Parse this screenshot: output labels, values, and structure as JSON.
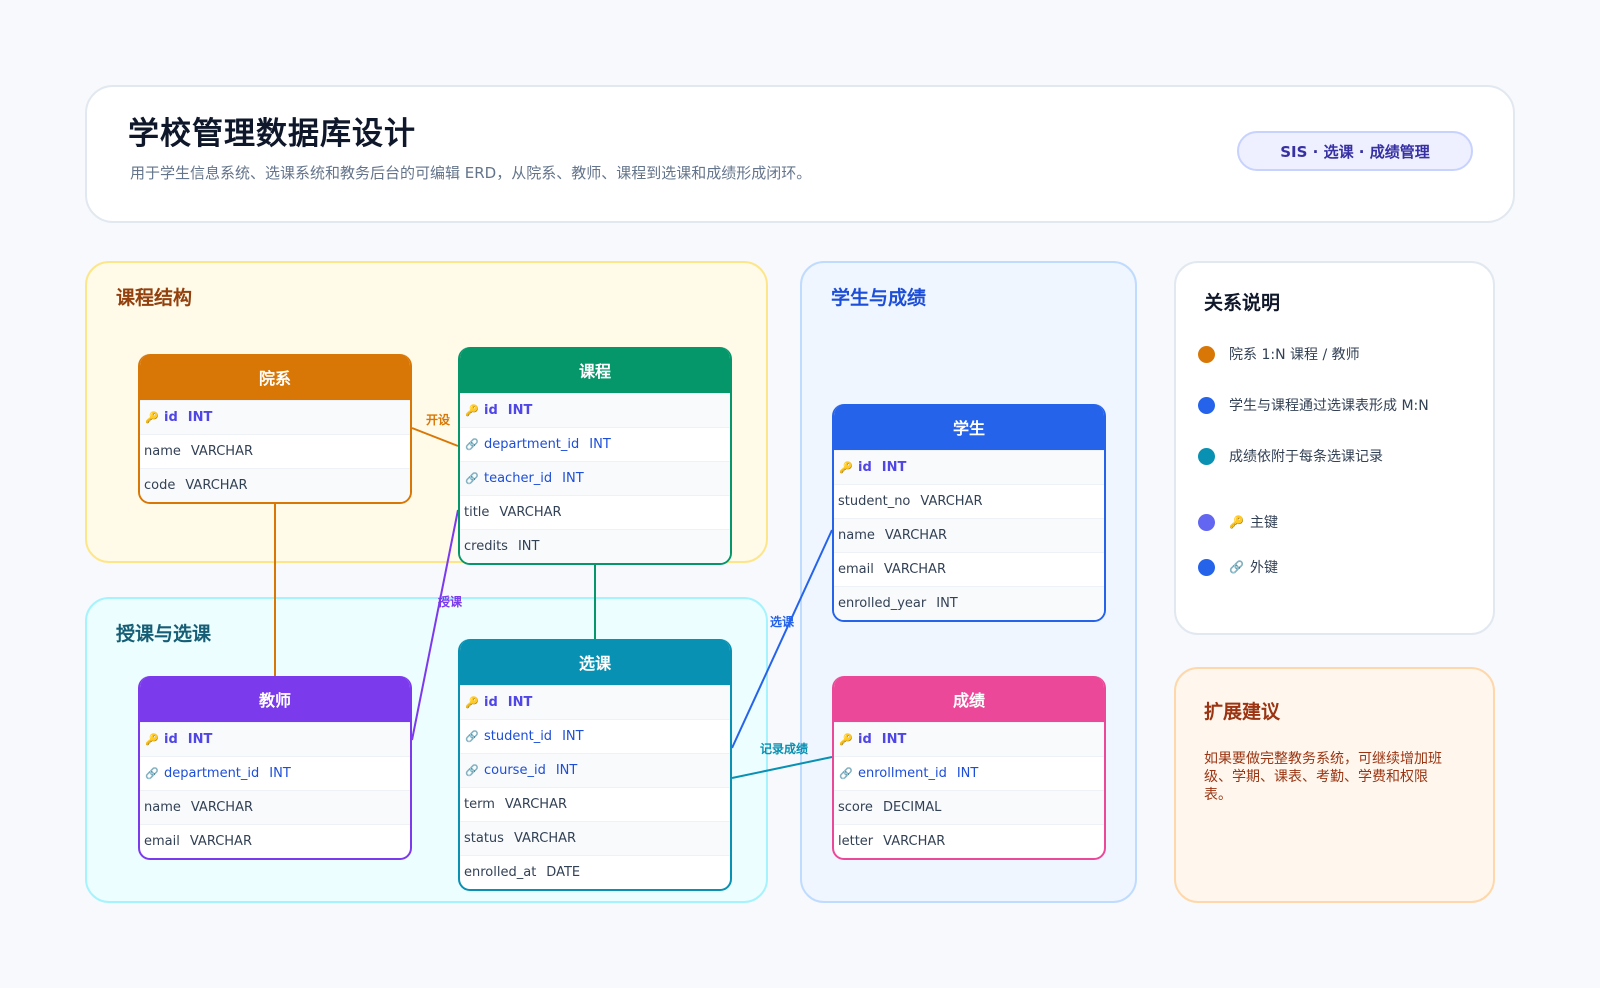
{
  "header": {
    "title": "学校管理数据库设计",
    "subtitle": "用于学生信息系统、选课系统和教务后台的可编辑 ERD，从院系、教师、课程到选课和成绩形成闭环。",
    "badge": "SIS · 选课 · 成绩管理"
  },
  "groups": {
    "course": "课程结构",
    "teach": "授课与选课",
    "student": "学生与成绩"
  },
  "entities": {
    "department": {
      "name": "院系",
      "color": "#d97706",
      "fields": [
        {
          "name": "id",
          "type": "INT",
          "key": "pk",
          "icon": "key-icon"
        },
        {
          "name": "name",
          "type": "VARCHAR",
          "key": ""
        },
        {
          "name": "code",
          "type": "VARCHAR",
          "key": ""
        }
      ]
    },
    "course": {
      "name": "课程",
      "color": "#059669",
      "fields": [
        {
          "name": "id",
          "type": "INT",
          "key": "pk",
          "icon": "key-icon"
        },
        {
          "name": "department_id",
          "type": "INT",
          "key": "fk",
          "icon": "link-icon"
        },
        {
          "name": "teacher_id",
          "type": "INT",
          "key": "fk",
          "icon": "link-icon"
        },
        {
          "name": "title",
          "type": "VARCHAR",
          "key": ""
        },
        {
          "name": "credits",
          "type": "INT",
          "key": ""
        }
      ]
    },
    "teacher": {
      "name": "教师",
      "color": "#7c3aed",
      "fields": [
        {
          "name": "id",
          "type": "INT",
          "key": "pk",
          "icon": "key-icon"
        },
        {
          "name": "department_id",
          "type": "INT",
          "key": "fk",
          "icon": "link-icon"
        },
        {
          "name": "name",
          "type": "VARCHAR",
          "key": ""
        },
        {
          "name": "email",
          "type": "VARCHAR",
          "key": ""
        }
      ]
    },
    "enrollment": {
      "name": "选课",
      "color": "#0891b2",
      "fields": [
        {
          "name": "id",
          "type": "INT",
          "key": "pk",
          "icon": "key-icon"
        },
        {
          "name": "student_id",
          "type": "INT",
          "key": "fk",
          "icon": "link-icon"
        },
        {
          "name": "course_id",
          "type": "INT",
          "key": "fk",
          "icon": "link-icon"
        },
        {
          "name": "term",
          "type": "VARCHAR",
          "key": ""
        },
        {
          "name": "status",
          "type": "VARCHAR",
          "key": ""
        },
        {
          "name": "enrolled_at",
          "type": "DATE",
          "key": ""
        }
      ]
    },
    "student": {
      "name": "学生",
      "color": "#2563eb",
      "fields": [
        {
          "name": "id",
          "type": "INT",
          "key": "pk",
          "icon": "key-icon"
        },
        {
          "name": "student_no",
          "type": "VARCHAR",
          "key": ""
        },
        {
          "name": "name",
          "type": "VARCHAR",
          "key": ""
        },
        {
          "name": "email",
          "type": "VARCHAR",
          "key": ""
        },
        {
          "name": "enrolled_year",
          "type": "INT",
          "key": ""
        }
      ]
    },
    "grade": {
      "name": "成绩",
      "color": "#ec4899",
      "fields": [
        {
          "name": "id",
          "type": "INT",
          "key": "pk",
          "icon": "key-icon"
        },
        {
          "name": "enrollment_id",
          "type": "INT",
          "key": "fk",
          "icon": "link-icon"
        },
        {
          "name": "score",
          "type": "DECIMAL",
          "key": ""
        },
        {
          "name": "letter",
          "type": "VARCHAR",
          "key": ""
        }
      ]
    }
  },
  "relations": {
    "offers": {
      "label": "开设",
      "color": "#d97706"
    },
    "teaches": {
      "label": "授课",
      "color": "#7c3aed"
    },
    "enrolls": {
      "label": "选课",
      "color": "#2563eb"
    },
    "records": {
      "label": "记录成绩",
      "color": "#0891b2"
    },
    "dept_teacher": {
      "color": "#d97706"
    },
    "course_enroll": {
      "color": "#059669"
    }
  },
  "legend": {
    "title": "关系说明",
    "items": [
      {
        "text": "院系 1:N 课程 / 教师",
        "color": "#d97706"
      },
      {
        "text": "学生与课程通过选课表形成 M:N",
        "color": "#2563eb"
      },
      {
        "text": "成绩依附于每条选课记录",
        "color": "#0891b2"
      },
      {
        "text": "主键",
        "color": "#6366f1",
        "icon": "key-icon"
      },
      {
        "text": "外键",
        "color": "#2563eb",
        "icon": "link-icon"
      }
    ]
  },
  "suggestion": {
    "title": "扩展建议",
    "text": "如果要做完整教务系统，可继续增加班级、学期、课表、考勤、学费和权限表。"
  }
}
